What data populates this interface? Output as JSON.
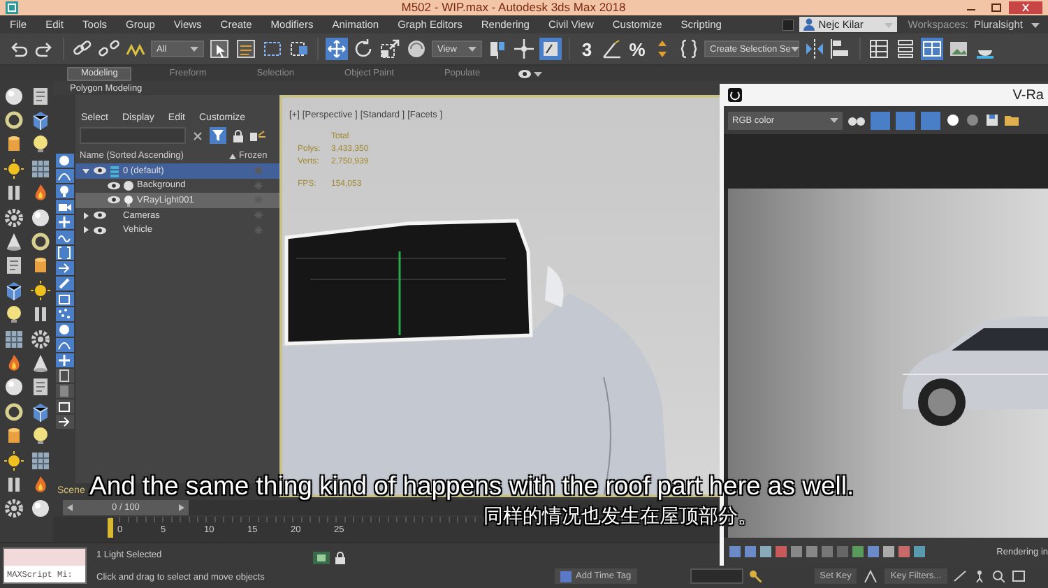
{
  "window": {
    "title": "M502 - WIP.max - Autodesk 3ds Max 2018"
  },
  "menu_bar": {
    "items": [
      "File",
      "Edit",
      "Tools",
      "Group",
      "Views",
      "Create",
      "Modifiers",
      "Animation",
      "Graph Editors",
      "Rendering",
      "Civil View",
      "Customize",
      "Scripting"
    ],
    "user": "Nejc Kilar",
    "workspaces_label": "Workspaces:",
    "workspace": "Pluralsight"
  },
  "toolbar": {
    "selection_filter": "All",
    "reference_coordinates": "View",
    "snap_toggle": "3",
    "percent_snap": "%",
    "selection_set": "Create Selection Se"
  },
  "ribbon": {
    "tabs": [
      {
        "label": "Modeling",
        "selected": true
      },
      {
        "label": "Freeform",
        "selected": false
      },
      {
        "label": "Selection",
        "selected": false
      },
      {
        "label": "Object Paint",
        "selected": false
      },
      {
        "label": "Populate",
        "selected": false
      }
    ],
    "panel": "Polygon Modeling"
  },
  "scene_explorer": {
    "menu": [
      "Select",
      "Display",
      "Edit",
      "Customize"
    ],
    "filters": [
      {
        "kind": "geometry",
        "on": true
      },
      {
        "kind": "shape",
        "on": true
      },
      {
        "kind": "light",
        "on": true
      },
      {
        "kind": "camera",
        "on": true
      },
      {
        "kind": "helper",
        "on": true
      },
      {
        "kind": "spacewarp",
        "on": true
      },
      {
        "kind": "group",
        "on": true
      },
      {
        "kind": "xref",
        "on": true
      },
      {
        "kind": "bone",
        "on": true
      },
      {
        "kind": "container",
        "on": true
      },
      {
        "kind": "particle",
        "on": true
      },
      {
        "kind": "geometry",
        "on": true
      },
      {
        "kind": "shape",
        "on": true
      },
      {
        "kind": "helper",
        "on": true
      },
      {
        "kind": "frozen",
        "on": false
      },
      {
        "kind": "hidden",
        "on": false
      },
      {
        "kind": "container",
        "on": false
      },
      {
        "kind": "xref",
        "on": false
      }
    ],
    "columns": [
      "Name (Sorted Ascending)",
      "Frozen"
    ],
    "tree": [
      {
        "name": "0 (default)",
        "kind": "layer",
        "expanded": true,
        "active": true,
        "selected": false,
        "frozen": false,
        "children": [
          {
            "name": "Background",
            "kind": "geometry",
            "active": false,
            "selected": false,
            "frozen": false
          },
          {
            "name": "VRayLight001",
            "kind": "light",
            "active": false,
            "selected": true,
            "frozen": false
          }
        ]
      },
      {
        "name": "Cameras",
        "kind": "group",
        "expanded": false,
        "active": false,
        "selected": false,
        "frozen": false
      },
      {
        "name": "Vehicle",
        "kind": "group",
        "expanded": false,
        "active": false,
        "selected": false,
        "frozen": false
      }
    ],
    "tab": "Scene"
  },
  "viewport": {
    "labels": [
      "[+]",
      "[Perspective ]",
      "[Standard ]",
      "[Facets ]"
    ],
    "stats": {
      "header": "Total",
      "rows": [
        {
          "label": "Polys:",
          "value": "3,433,350"
        },
        {
          "label": "Verts:",
          "value": "2,750,939"
        },
        {
          "label": "FPS:",
          "value": "154,053"
        }
      ]
    }
  },
  "frame_buffer": {
    "title": "V-Ra",
    "channel": "RGB color",
    "status": "Rendering in"
  },
  "timeline": {
    "frame": "0 / 100",
    "ticks": [
      "0",
      "5",
      "10",
      "15",
      "20",
      "25"
    ]
  },
  "status_bar": {
    "script_listener": "MAXScript Mi:",
    "selection": "1 Light Selected",
    "prompt": "Click and drag to select and move objects",
    "add_time_tag": "Add Time Tag",
    "set_key": "Set Key",
    "key_filters": "Key Filters..."
  },
  "captions": [
    "And the same thing kind of happens with the roof part here as well.",
    "同样的情况也发生在屋顶部分。"
  ]
}
